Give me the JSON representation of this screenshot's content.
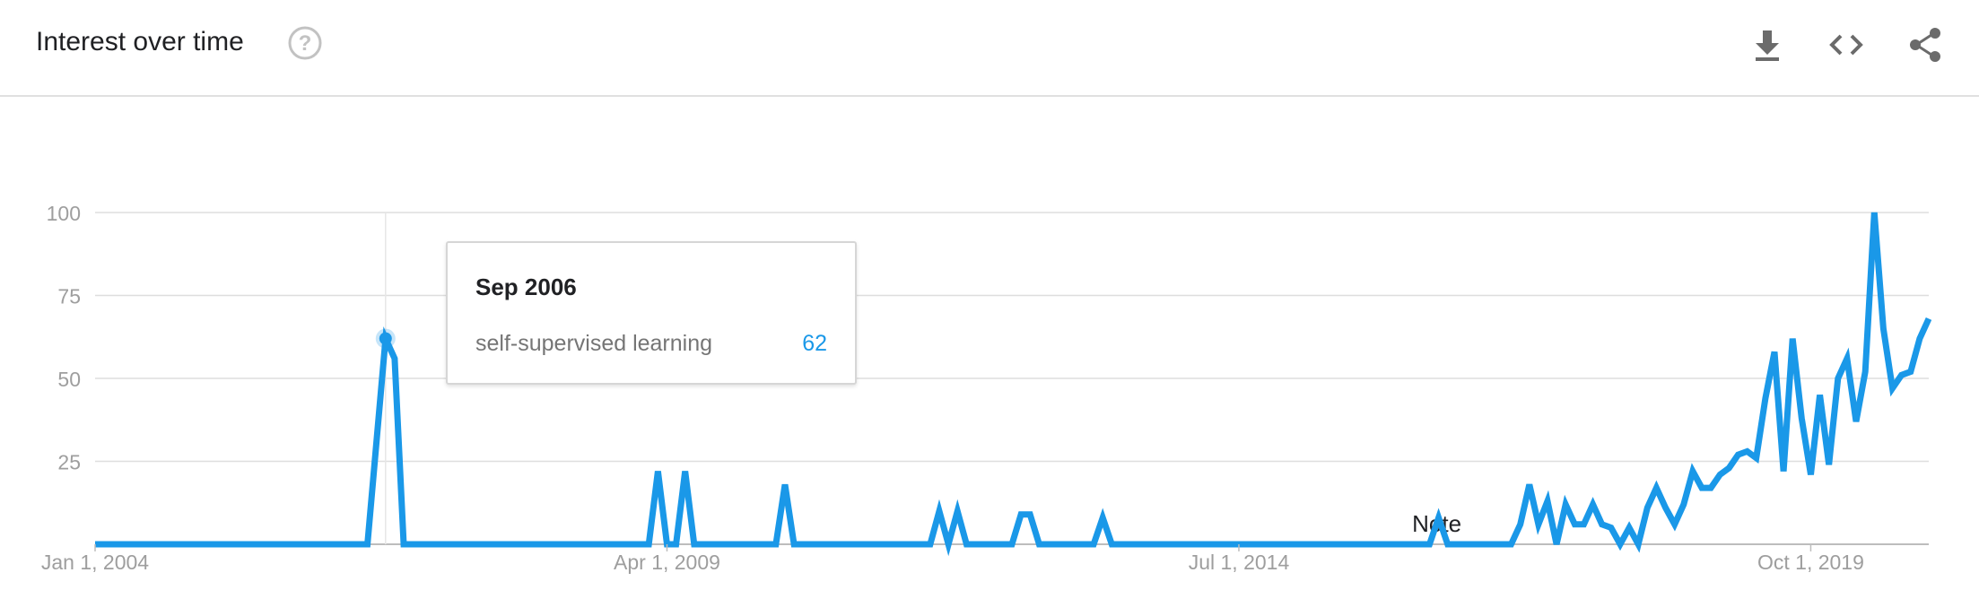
{
  "header": {
    "title": "Interest over time",
    "icons": [
      "help-icon",
      "download-icon",
      "embed-icon",
      "share-icon"
    ]
  },
  "colors": {
    "series": "#1a98e8",
    "grid": "#dedede",
    "tick": "#9e9e9e"
  },
  "tooltip": {
    "date": "Sep 2006",
    "term": "self-supervised learning",
    "value": "62"
  },
  "chart_data": {
    "type": "line",
    "title": "",
    "xlabel": "",
    "ylabel": "",
    "ylim": [
      0,
      100
    ],
    "yticks": [
      25,
      50,
      75,
      100
    ],
    "xtick_labels": [
      "Jan 1, 2004",
      "Apr 1, 2009",
      "Jul 1, 2014",
      "Oct 1, 2019"
    ],
    "xtick_dates": [
      "2004-01",
      "2009-04",
      "2014-07",
      "2019-10"
    ],
    "annotation": {
      "label": "Note",
      "date": "2016-05"
    },
    "highlight": {
      "date": "2006-09",
      "value": 62
    },
    "grid": true,
    "legend": "none",
    "series": [
      {
        "points": [
          [
            "2004-01",
            0
          ],
          [
            "2006-07",
            0
          ],
          [
            "2006-09",
            62
          ],
          [
            "2006-10",
            56
          ],
          [
            "2006-11",
            0
          ],
          [
            "2009-02",
            0
          ],
          [
            "2009-03",
            22
          ],
          [
            "2009-04",
            0
          ],
          [
            "2009-05",
            0
          ],
          [
            "2009-06",
            22
          ],
          [
            "2009-07",
            0
          ],
          [
            "2010-04",
            0
          ],
          [
            "2010-05",
            18
          ],
          [
            "2010-06",
            0
          ],
          [
            "2011-09",
            0
          ],
          [
            "2011-10",
            10
          ],
          [
            "2011-11",
            0
          ],
          [
            "2011-12",
            10
          ],
          [
            "2012-01",
            0
          ],
          [
            "2012-06",
            0
          ],
          [
            "2012-07",
            9
          ],
          [
            "2012-08",
            9
          ],
          [
            "2012-09",
            0
          ],
          [
            "2013-03",
            0
          ],
          [
            "2013-04",
            8
          ],
          [
            "2013-05",
            0
          ],
          [
            "2016-04",
            0
          ],
          [
            "2016-05",
            8
          ],
          [
            "2016-06",
            0
          ],
          [
            "2017-01",
            0
          ],
          [
            "2017-02",
            6
          ],
          [
            "2017-03",
            18
          ],
          [
            "2017-04",
            6
          ],
          [
            "2017-05",
            13
          ],
          [
            "2017-06",
            0
          ],
          [
            "2017-07",
            12
          ],
          [
            "2017-08",
            6
          ],
          [
            "2017-09",
            6
          ],
          [
            "2017-10",
            12
          ],
          [
            "2017-11",
            6
          ],
          [
            "2017-12",
            5
          ],
          [
            "2018-01",
            0
          ],
          [
            "2018-02",
            5
          ],
          [
            "2018-03",
            0
          ],
          [
            "2018-04",
            11
          ],
          [
            "2018-05",
            17
          ],
          [
            "2018-06",
            11
          ],
          [
            "2018-07",
            6
          ],
          [
            "2018-08",
            12
          ],
          [
            "2018-09",
            22
          ],
          [
            "2018-10",
            17
          ],
          [
            "2018-11",
            17
          ],
          [
            "2018-12",
            21
          ],
          [
            "2019-01",
            23
          ],
          [
            "2019-02",
            27
          ],
          [
            "2019-03",
            28
          ],
          [
            "2019-04",
            26
          ],
          [
            "2019-05",
            44
          ],
          [
            "2019-06",
            58
          ],
          [
            "2019-07",
            22
          ],
          [
            "2019-08",
            62
          ],
          [
            "2019-09",
            38
          ],
          [
            "2019-10",
            21
          ],
          [
            "2019-11",
            45
          ],
          [
            "2019-12",
            24
          ],
          [
            "2020-01",
            50
          ],
          [
            "2020-02",
            56
          ],
          [
            "2020-03",
            37
          ],
          [
            "2020-04",
            52
          ],
          [
            "2020-05",
            100
          ],
          [
            "2020-06",
            65
          ],
          [
            "2020-07",
            47
          ],
          [
            "2020-08",
            51
          ],
          [
            "2020-09",
            52
          ],
          [
            "2020-10",
            62
          ],
          [
            "2020-11",
            68
          ]
        ]
      }
    ]
  }
}
